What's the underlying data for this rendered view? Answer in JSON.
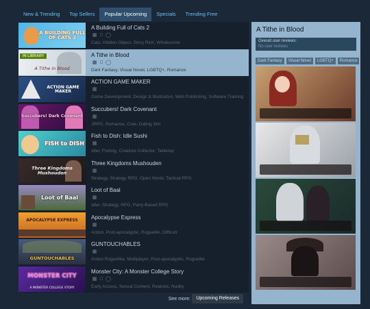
{
  "tabs": [
    {
      "label": "New & Trending"
    },
    {
      "label": "Top Sellers"
    },
    {
      "label": "Popular Upcoming"
    },
    {
      "label": "Specials"
    },
    {
      "label": "Trending Free"
    }
  ],
  "games": [
    {
      "title": "A Building Full of Cats 2",
      "tags": "Cats, Hidden Object, Story Rich, Wholesome",
      "platforms": [
        "windows-icon",
        "mac-icon",
        "steam-icon"
      ],
      "capsule_text": "A BUILDING FULL OF CATS 2"
    },
    {
      "title": "A Tithe in Blood",
      "tags": "Dark Fantasy, Visual Novel, LGBTQ+, Romance",
      "platforms": [
        "windows-icon",
        "mac-icon",
        "steam-icon"
      ],
      "in_library": "IN LIBRARY",
      "capsule_text": "A Tithe in Blood"
    },
    {
      "title": "ACTION GAME MAKER",
      "tags": "Game Development, Design & Illustration, Web Publishing, Software Training",
      "platforms": [
        "windows-icon"
      ],
      "capsule_text": "ACTION GAME MAKER"
    },
    {
      "title": "Succubers! Dark Covenant",
      "tags": "JRPG, Romance, Cute, Dating Sim",
      "platforms": [
        "windows-icon"
      ],
      "capsule_text": "Succubers! Dark Covenant"
    },
    {
      "title": "Fish to Dish: Idle Sushi",
      "tags": "Idler, Fishing, Creature Collector, Tabletop",
      "platforms": [
        "windows-icon"
      ],
      "capsule_text": "FISH to DISH"
    },
    {
      "title": "Three Kingdoms Mushouden",
      "tags": "Strategy, Strategy RPG, Open World, Tactical RPG",
      "platforms": [
        "windows-icon"
      ],
      "capsule_text": "Three Kingdoms Mushouden"
    },
    {
      "title": "Loot of Baal",
      "tags": "Idler, Strategy, RPG, Party-Based RPG",
      "platforms": [
        "windows-icon"
      ],
      "capsule_text": "Loot of Baal"
    },
    {
      "title": "Apocalypse Express",
      "tags": "Action, Post-apocalyptic, Roguelite, Difficult",
      "platforms": [
        "windows-icon"
      ],
      "capsule_text": "APOCALYPSE EXPRESS"
    },
    {
      "title": "GUNTOUCHABLES",
      "tags": "Action Roguelike, Multiplayer, Post-apocalyptic, Roguelite",
      "platforms": [
        "windows-icon"
      ],
      "capsule_text": "GUNTOUCHABLES"
    },
    {
      "title": "Monster City: A Monster College Story",
      "tags": "Early Access, Sexual Content, Realistic, Nudity",
      "platforms": [
        "windows-icon",
        "mac-icon",
        "steam-icon"
      ],
      "capsule_text": "MONSTER CITY",
      "capsule_sub": "A MONSTER COLLEGE STORY"
    }
  ],
  "see_more": {
    "label": "See more:",
    "button": "Upcoming Releases"
  },
  "detail": {
    "title": "A Tithe in Blood",
    "review_heading": "Overall user reviews:",
    "review_value": "No user reviews",
    "tags": [
      "Dark Fantasy",
      "Visual Novel",
      "LGBTQ+",
      "Romance"
    ]
  },
  "colors": {
    "background": "#1b2838",
    "link": "#67c1f5",
    "selected_row": "#95b5cf",
    "in_library": "#5c7e10"
  }
}
